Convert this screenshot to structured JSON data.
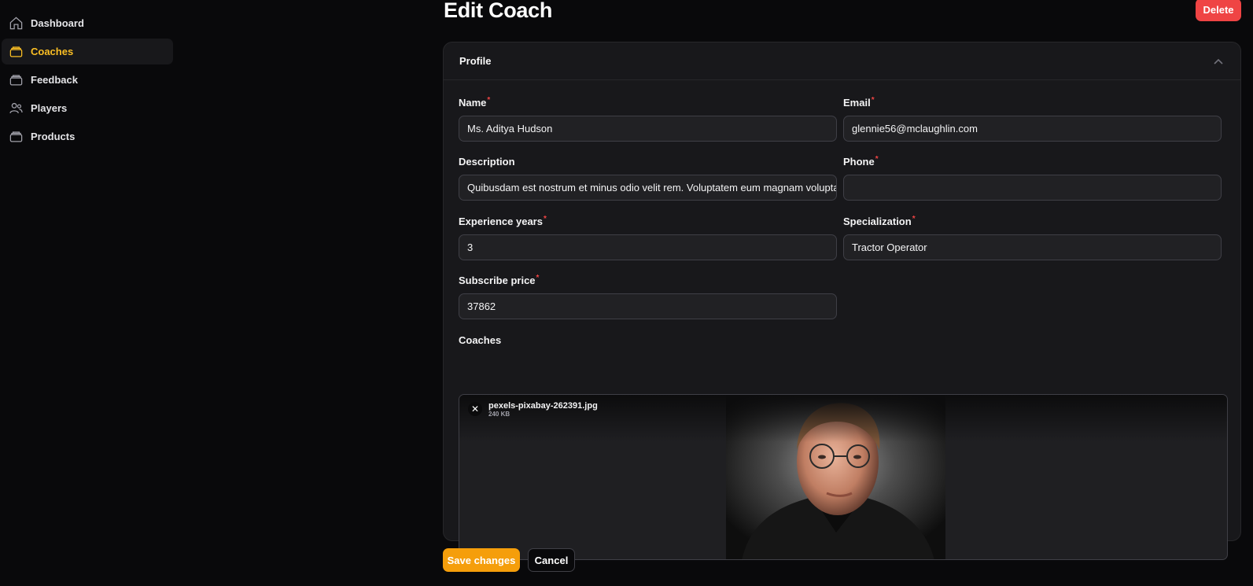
{
  "sidebar": {
    "items": [
      {
        "label": "Dashboard",
        "icon": "home-icon",
        "active": false
      },
      {
        "label": "Coaches",
        "icon": "stack-icon",
        "active": true
      },
      {
        "label": "Feedback",
        "icon": "stack-icon",
        "active": false
      },
      {
        "label": "Players",
        "icon": "users-icon",
        "active": false
      },
      {
        "label": "Products",
        "icon": "stack-icon",
        "active": false
      }
    ]
  },
  "header": {
    "title": "Edit Coach",
    "delete_label": "Delete"
  },
  "profile": {
    "title": "Profile",
    "fields": {
      "name": {
        "label": "Name",
        "required_mark": "*",
        "value": "Ms. Aditya Hudson"
      },
      "email": {
        "label": "Email",
        "required_mark": "*",
        "value": "glennie56@mclaughlin.com"
      },
      "description": {
        "label": "Description",
        "value": "Quibusdam est nostrum et minus odio velit rem. Voluptatem eum magnam voluptate"
      },
      "phone": {
        "label": "Phone",
        "required_mark": "*",
        "value": ""
      },
      "experience": {
        "label": "Experience years",
        "required_mark": "*",
        "value": "3"
      },
      "specialization": {
        "label": "Specialization",
        "required_mark": "*",
        "value": "Tractor Operator"
      },
      "price": {
        "label": "Subscribe price",
        "required_mark": "*",
        "value": "37862"
      }
    },
    "upload": {
      "label": "Coaches",
      "file_name": "pexels-pixabay-262391.jpg",
      "file_size": "240 KB",
      "remove_glyph": "✕"
    }
  },
  "actions": {
    "save_label": "Save changes",
    "cancel_label": "Cancel"
  },
  "colors": {
    "accent": "#f59e0b",
    "active_nav_text": "#fbbf24",
    "danger": "#ef4444",
    "background": "#09090b",
    "card": "#18181b"
  }
}
